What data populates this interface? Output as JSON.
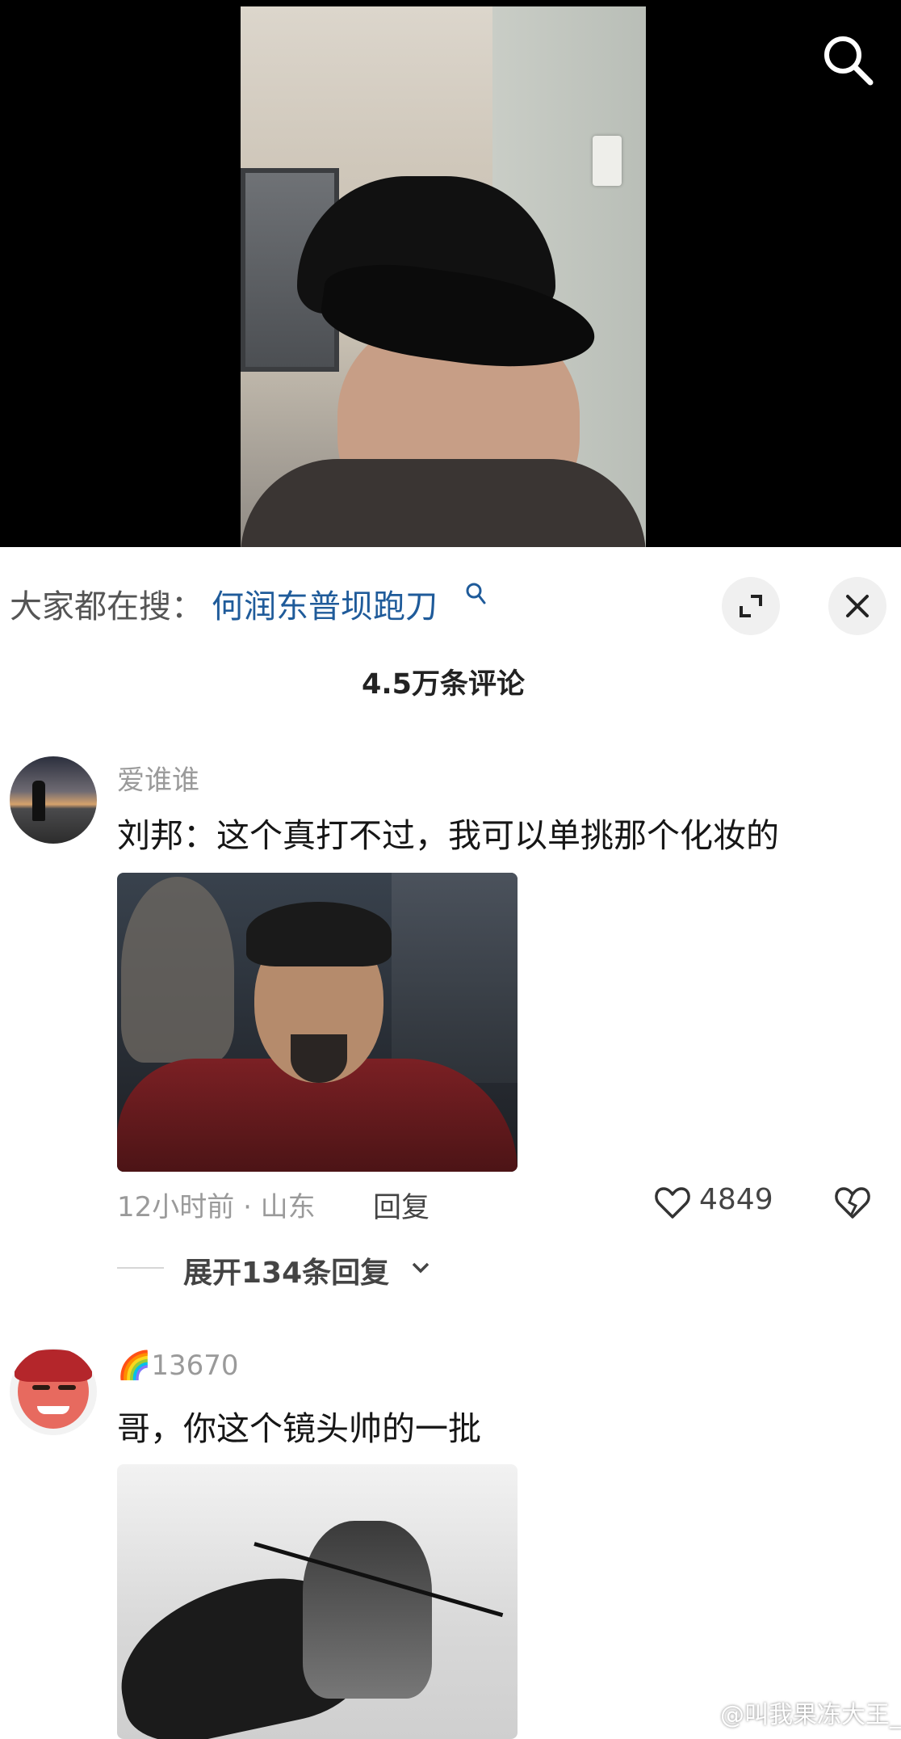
{
  "suggestion": {
    "label": "大家都在搜：",
    "query": "何润东普坝跑刀"
  },
  "comments_header": {
    "count_text": "4.5万条评论"
  },
  "comments": [
    {
      "username": "爱谁谁",
      "text": "刘邦：这个真打不过，我可以单挑那个化妆的",
      "meta": "12小时前 · 山东",
      "reply_label": "回复",
      "likes": "4849",
      "expand_replies": "展开134条回复"
    },
    {
      "username_emoji": "🌈",
      "username": "13670",
      "text": "哥，你这个镜头帅的一批"
    }
  ],
  "watermark": {
    "text": "@叫我果冻大王_"
  },
  "icons": {
    "top_search": "search-icon",
    "expand": "expand-icon",
    "close": "close-icon",
    "like": "heart-icon",
    "dislike": "broken-heart-icon"
  },
  "colors": {
    "link": "#1f5b9a",
    "muted": "#9a9a9a"
  }
}
